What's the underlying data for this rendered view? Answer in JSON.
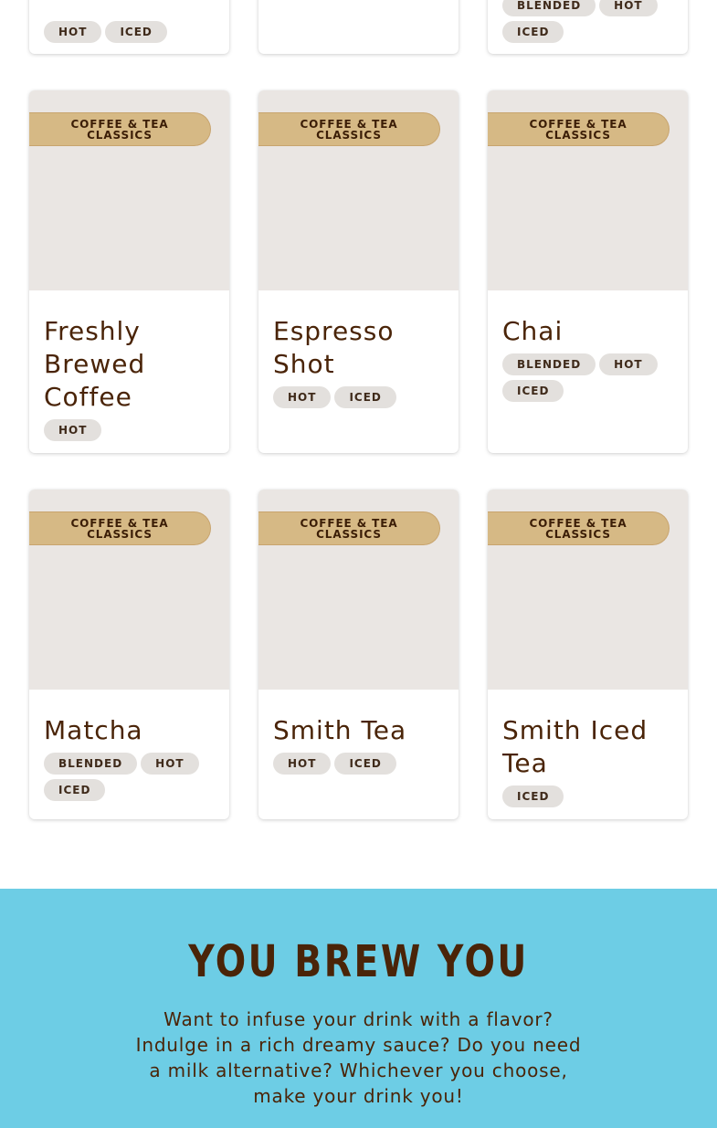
{
  "top_row": [
    {
      "tags": [
        "HOT",
        "ICED"
      ]
    },
    {
      "tags": []
    },
    {
      "tags": [
        "BLENDED",
        "HOT",
        "ICED"
      ]
    }
  ],
  "cards": [
    {
      "category": "COFFEE & TEA CLASSICS",
      "title": "Freshly Brewed Coffee",
      "tags": [
        "HOT"
      ]
    },
    {
      "category": "COFFEE & TEA CLASSICS",
      "title": "Espresso Shot",
      "tags": [
        "HOT",
        "ICED"
      ]
    },
    {
      "category": "COFFEE & TEA CLASSICS",
      "title": "Chai",
      "tags": [
        "BLENDED",
        "HOT",
        "ICED"
      ]
    },
    {
      "category": "COFFEE & TEA CLASSICS",
      "title": "Matcha",
      "tags": [
        "BLENDED",
        "HOT",
        "ICED"
      ]
    },
    {
      "category": "COFFEE & TEA CLASSICS",
      "title": "Smith Tea",
      "tags": [
        "HOT",
        "ICED"
      ]
    },
    {
      "category": "COFFEE & TEA CLASSICS",
      "title": "Smith Iced Tea",
      "tags": [
        "ICED"
      ]
    }
  ],
  "banner": {
    "title": "YOU BREW YOU",
    "text": "Want to infuse your drink with a flavor? Indulge in a rich dreamy sauce? Do you need a milk alternative? Whichever you choose, make your drink you!"
  },
  "colors": {
    "brand_brown": "#4a2408",
    "badge_tan": "#d6b985",
    "banner_blue": "#6dcde5",
    "image_placeholder": "#eae6e3",
    "tag_gray": "#e3e0dd"
  }
}
